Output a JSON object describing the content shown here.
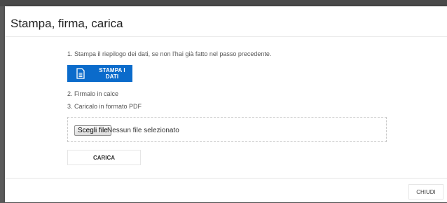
{
  "dialog": {
    "title": "Stampa, firma, carica"
  },
  "steps": {
    "step1": "1. Stampa il riepilogo dei dati, se non l'hai già fatto nel passo precedente.",
    "step2": "2. Firmalo in calce",
    "step3": "3. Caricalo in formato PDF"
  },
  "print_button": {
    "label": "STAMPA I DATI",
    "icon": "document-icon"
  },
  "file_input": {
    "button_label": "Scegli file",
    "status": "Nessun file selezionato"
  },
  "upload_button": {
    "label": "CARICA"
  },
  "footer": {
    "close_label": "CHIUDI"
  },
  "colors": {
    "primary": "#0b6bcb",
    "backdrop": "#5a5a5a"
  }
}
